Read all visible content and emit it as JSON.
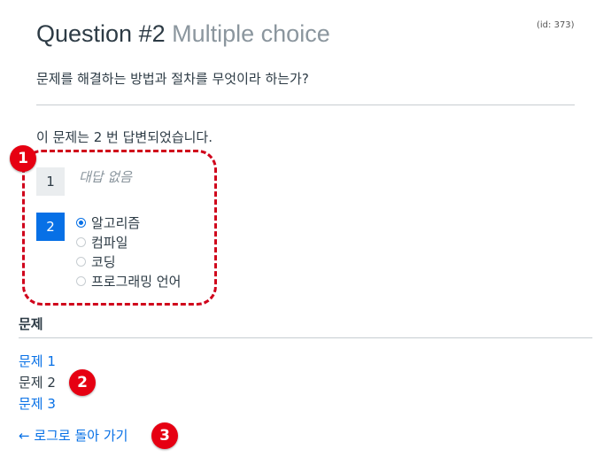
{
  "question": {
    "title": "Question #2",
    "type": "Multiple choice",
    "id_label": "(id: 373)",
    "text": "문제를 해결하는 방법과 절차를 무엇이라 하는가?"
  },
  "answered_text": "이 문제는 2 번 답변되었습니다.",
  "responses": [
    {
      "number": "1",
      "no_answer": "대답 없음"
    },
    {
      "number": "2"
    }
  ],
  "options": [
    {
      "label": "알고리즘",
      "checked": true
    },
    {
      "label": "컴파일",
      "checked": false
    },
    {
      "label": "코딩",
      "checked": false
    },
    {
      "label": "프로그래밍 언어",
      "checked": false
    }
  ],
  "questions_section": {
    "title": "문제",
    "items": [
      "문제 1",
      "문제 2",
      "문제 3"
    ]
  },
  "back_link": "← 로그로 돌아 가기",
  "badges": [
    "1",
    "2",
    "3"
  ],
  "colors": {
    "accent": "#0770e6",
    "badge": "#e60012",
    "annotation_border": "#d0021b"
  }
}
